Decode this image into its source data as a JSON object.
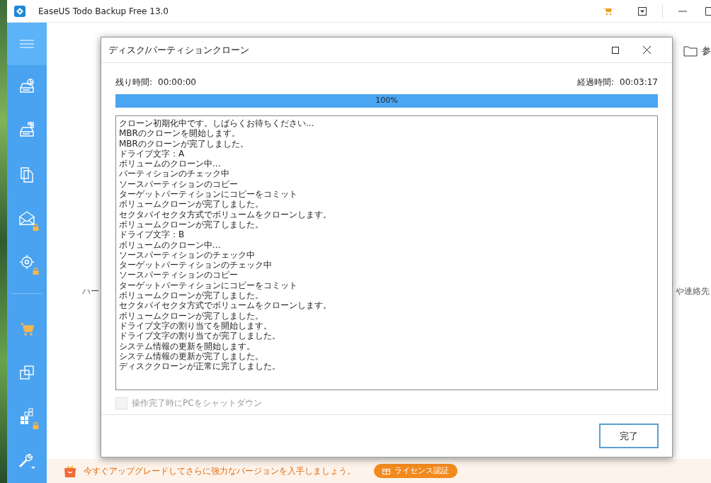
{
  "app_window": {
    "title": "EaseUS Todo Backup Free 13.0"
  },
  "sidebar": {
    "items": [
      {
        "locked": false
      },
      {
        "locked": false
      },
      {
        "locked": false
      },
      {
        "locked": true
      },
      {
        "locked": true
      }
    ],
    "bottom_items": [
      {
        "locked": false
      },
      {
        "locked": false
      },
      {
        "locked": true
      },
      {
        "locked": false
      }
    ]
  },
  "background": {
    "browse_label": "参",
    "left_label": "ハー",
    "right_label": "や連絡先"
  },
  "dialog": {
    "title": "ディスク/パーティションクローン",
    "remaining_label": "残り時間:",
    "remaining_value": "00:00:00",
    "elapsed_label": "経過時間:",
    "elapsed_value": "00:03:17",
    "progress": {
      "level": 1.0,
      "text": "100%"
    },
    "log": [
      "クローン初期化中です。しばらくお待ちください...",
      "MBRのクローンを開始します。",
      "MBRのクローンが完了しました。",
      "ドライブ文字：A",
      "ボリュームのクローン中...",
      "パーティションのチェック中",
      "ソースパーティションのコピー",
      "ターゲットパーティションにコピーをコミット",
      "ボリュームクローンが完了しました。",
      "セクタバイセクタ方式でボリュームをクローンします。",
      "ボリュームクローンが完了しました。",
      "ドライブ文字：B",
      "ボリュームのクローン中...",
      "ソースパーティションのチェック中",
      "ターゲットパーティションのチェック中",
      "ソースパーティションのコピー",
      "ターゲットパーティションにコピーをコミット",
      "ボリュームクローンが完了しました。",
      "セクタバイセクタ方式でボリュームをクローンします。",
      "ボリュームクローンが完了しました。",
      "ドライブ文字の割り当てを開始します。",
      "ドライブ文字の割り当てが完了しました。",
      "システム情報の更新を開始します。",
      "システム情報の更新が完了しました。",
      "ディスククローンが正常に完了しました。"
    ],
    "shutdown": {
      "label": "操作完了時にPCをシャットダウン",
      "checked": false,
      "disabled": true
    },
    "finish_button": "完了"
  },
  "banner": {
    "text": "今すぐアップグレードしてさらに強力なバージョンを入手しましょう。",
    "button": "ライセンス認証"
  }
}
